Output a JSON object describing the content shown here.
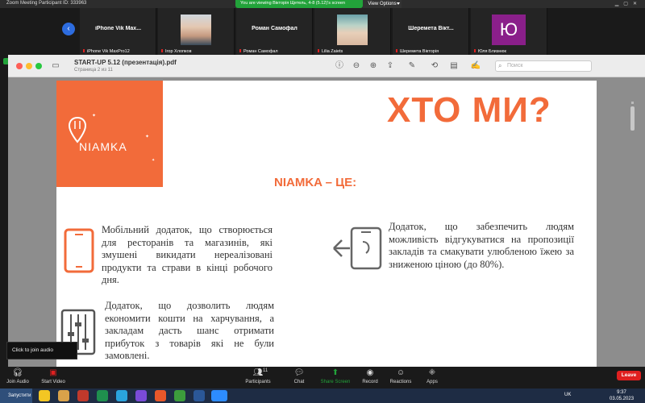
{
  "zoom": {
    "title": "Zoom Meeting Participant ID: 333963",
    "sharing_banner": "You are viewing Вікторія Щетель, 4-8 (5.12)'s screen",
    "view_options": "View Options"
  },
  "participants": [
    {
      "center_name": "iPhone Vik Max...",
      "bottom_name": "iPhone Vik MaxPro12"
    },
    {
      "center_name": "",
      "bottom_name": "Ігор Хлопков"
    },
    {
      "center_name": "Роман Самофал",
      "bottom_name": "Роман Самофал"
    },
    {
      "center_name": "",
      "bottom_name": "Lilia Zaiets"
    },
    {
      "center_name": "Шеремета Вікт...",
      "bottom_name": "Шеремета Вікторія"
    },
    {
      "center_name": "",
      "bottom_name": "Юля Близнюк",
      "avatar_letter": "Ю"
    }
  ],
  "preview": {
    "doc_title": "START-UP 5.12 (презентація).pdf",
    "page_info": "Страница 2 из 11",
    "search_placeholder": "Поиск"
  },
  "slide": {
    "logo": "NIAMKA",
    "title": "ХТО МИ?",
    "subtitle": "NIAMKA – ЦЕ:",
    "features": [
      "Мобільний додаток, що створюється для ресторанів та магазинів, які змушені викидати нереалізовані продукти та страви в кінці робочого дня.",
      "Додаток, що забезпечить людям можливість відгукуватися на пропозиції закладів та смакувати улюбленою їжею за зниженою ціною (до 80%).",
      "Додаток, що дозволить людям економити кошти на харчування, а закладам дасть шанс отримати прибуток з товарів які не були замовлені."
    ]
  },
  "zoom_bar": {
    "tooltip": "Click to join audio",
    "buttons": [
      {
        "label": "Join Audio"
      },
      {
        "label": "Start Video"
      },
      {
        "label": "Participants",
        "count": "11"
      },
      {
        "label": "Chat"
      },
      {
        "label": "Share Screen"
      },
      {
        "label": "Record"
      },
      {
        "label": "Reactions"
      },
      {
        "label": "Apps"
      }
    ],
    "leave": "Leave"
  },
  "taskbar": {
    "start": "Запустити",
    "lang": "UK",
    "time": "9:37",
    "date": "03.05.2023"
  },
  "colors": {
    "accent": "#f26b3a",
    "zoom_green": "#22a33a",
    "leave_red": "#e02020"
  }
}
